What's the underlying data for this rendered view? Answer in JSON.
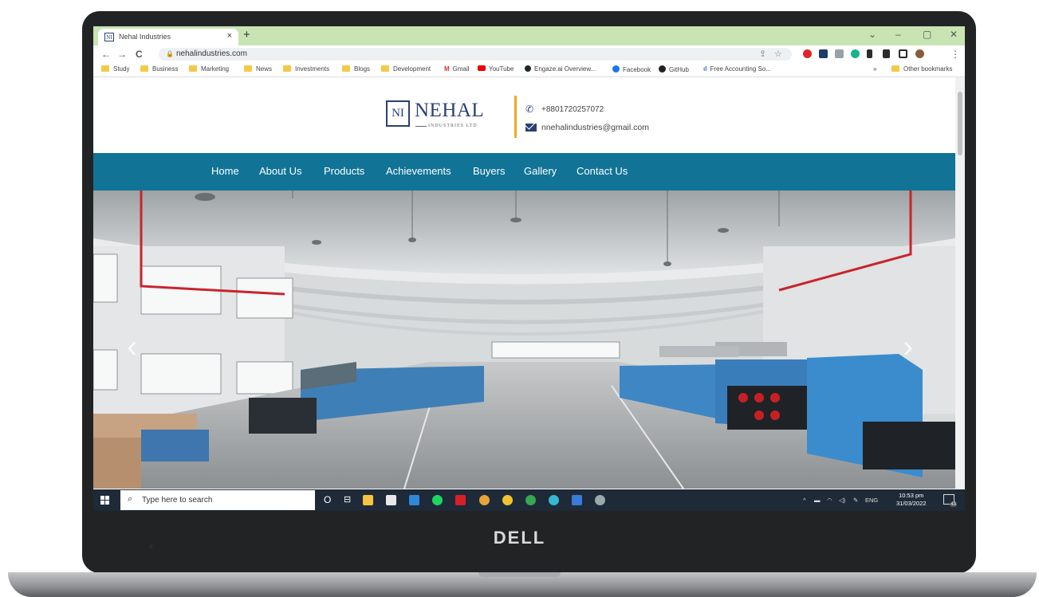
{
  "browser": {
    "tab_title": "Nehal Industries",
    "tab_favicon": "NI",
    "new_tab": "+",
    "close_tab": "×",
    "url": "nehalindustries.com",
    "window_controls": [
      "⌄",
      "–",
      "▢",
      "✕"
    ],
    "nav": [
      "←",
      "→",
      "C"
    ],
    "bookmarks": [
      "Study",
      "Business",
      "Marketing",
      "News",
      "Investments",
      "Blogs",
      "Development",
      "Gmail",
      "YouTube",
      "Engaze.ai Overview...",
      "Facebook",
      "GitHub",
      "Free Accounting So..."
    ],
    "more_bookmarks": "»",
    "other_bookmarks": "Other bookmarks"
  },
  "site": {
    "logo_mark": "NI",
    "logo_name": "NEHAL",
    "logo_sub": "INDUSTRIES LTD",
    "phone": "+8801720257072",
    "email": "nnehalindustries@gmail.com",
    "nav": [
      "Home",
      "About Us",
      "Products",
      "Achievements",
      "Buyers",
      "Gallery",
      "Contact Us"
    ],
    "slider_prev": "‹",
    "slider_next": "›"
  },
  "taskbar": {
    "search_placeholder": "Type here to search",
    "task_view": "O",
    "language": "ENG",
    "time": "10:53 pm",
    "date": "31/03/2022",
    "notification_count": "43"
  },
  "laptop": {
    "brand": "DELL"
  },
  "colors": {
    "nav_bg": "#117396",
    "logo_blue": "#2a3f73",
    "accent": "#f0a820",
    "tabbar_bg": "#c8e4b3"
  }
}
